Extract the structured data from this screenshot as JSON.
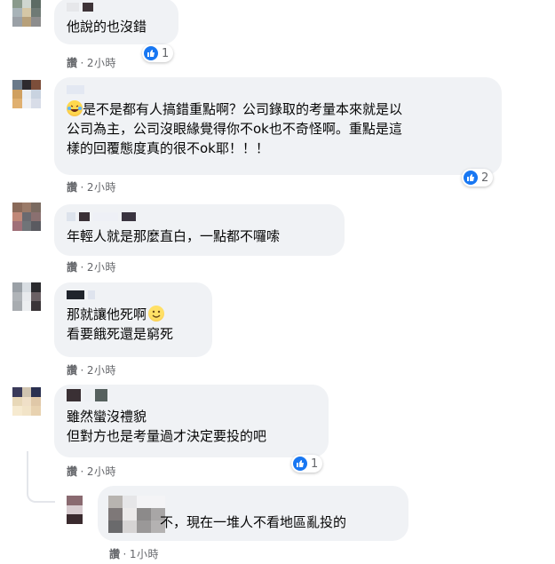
{
  "comments": [
    {
      "text_lines": [
        "他說的也沒錯"
      ],
      "action_label": "讚",
      "time": "2小時",
      "reaction_count": "1"
    },
    {
      "text_lines": [
        "是不是都有人搞錯重點啊？公司錄取的考量本來就是以",
        "公司為主，公司沒眼緣覺得你不ok也不奇怪啊。重點是這",
        "樣的回覆態度真的很不ok耶！！！"
      ],
      "action_label": "讚",
      "time": "2小時",
      "reaction_count": "2"
    },
    {
      "text_lines": [
        "年輕人就是那麼直白，一點都不囉嗦"
      ],
      "action_label": "讚",
      "time": "2小時"
    },
    {
      "text_lines": [
        "那就讓他死啊",
        "看要餓死還是窮死"
      ],
      "action_label": "讚",
      "time": "2小時"
    },
    {
      "text_lines": [
        "雖然蠻沒禮貌",
        "但對方也是考量過才決定要投的吧"
      ],
      "action_label": "讚",
      "time": "2小時",
      "reaction_count": "1"
    }
  ],
  "reply": {
    "text": "不，現在一堆人不看地區亂投的",
    "action_label": "讚",
    "time": "1小時"
  },
  "separator": "·",
  "icons": {
    "like": "like-icon",
    "emoji_laugh": "laughing-crying-emoji",
    "emoji_smile": "smile-emoji"
  },
  "colors": {
    "bubble": "#f0f2f5",
    "like_blue": "#1877f2",
    "meta_gray": "#65676b"
  }
}
